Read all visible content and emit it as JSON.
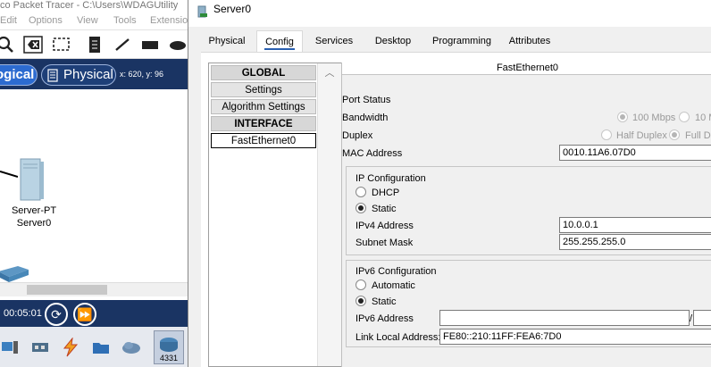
{
  "app": {
    "title": "co Packet Tracer - C:\\Users\\WDAGUtility",
    "menu": [
      "Edit",
      "Options",
      "View",
      "Tools",
      "Extensio"
    ],
    "mode_logical": "ogical",
    "mode_physical": "Physical",
    "coords": "x: 620, y: 96",
    "server_label_type": "Server-PT",
    "server_label_name": "Server0",
    "time": "00:05:01",
    "device_4331": "4331",
    "colors": {
      "mode_bar": "#1a3463",
      "logical_active": "#2c6bd0"
    }
  },
  "dialog": {
    "title": "Server0",
    "tabs": [
      "Physical",
      "Config",
      "Services",
      "Desktop",
      "Programming",
      "Attributes"
    ],
    "active_tab": "Config",
    "sidebar": {
      "global_header": "GLOBAL",
      "settings": "Settings",
      "algorithm_settings": "Algorithm Settings",
      "interface_header": "INTERFACE",
      "fastethernet": "FastEthernet0"
    },
    "panel": {
      "header": "FastEthernet0",
      "port_status": "Port Status",
      "bandwidth": "Bandwidth",
      "bandwidth_opt1": "100 Mbps",
      "bandwidth_opt2": "10 M",
      "duplex": "Duplex",
      "duplex_opt1": "Half Duplex",
      "duplex_opt2": "Full Du",
      "mac_label": "MAC Address",
      "mac_value": "0010.11A6.07D0",
      "ip_config": "IP Configuration",
      "dhcp": "DHCP",
      "static": "Static",
      "ipv4_label": "IPv4 Address",
      "ipv4_value": "10.0.0.1",
      "subnet_label": "Subnet Mask",
      "subnet_value": "255.255.255.0",
      "ipv6_config": "IPv6 Configuration",
      "automatic": "Automatic",
      "static6": "Static",
      "ipv6_label": "IPv6 Address",
      "ipv6_value": "",
      "ipv6_sep": "/",
      "linklocal_label": "Link Local Address:",
      "linklocal_value": "FE80::210:11FF:FEA6:7D0"
    }
  }
}
